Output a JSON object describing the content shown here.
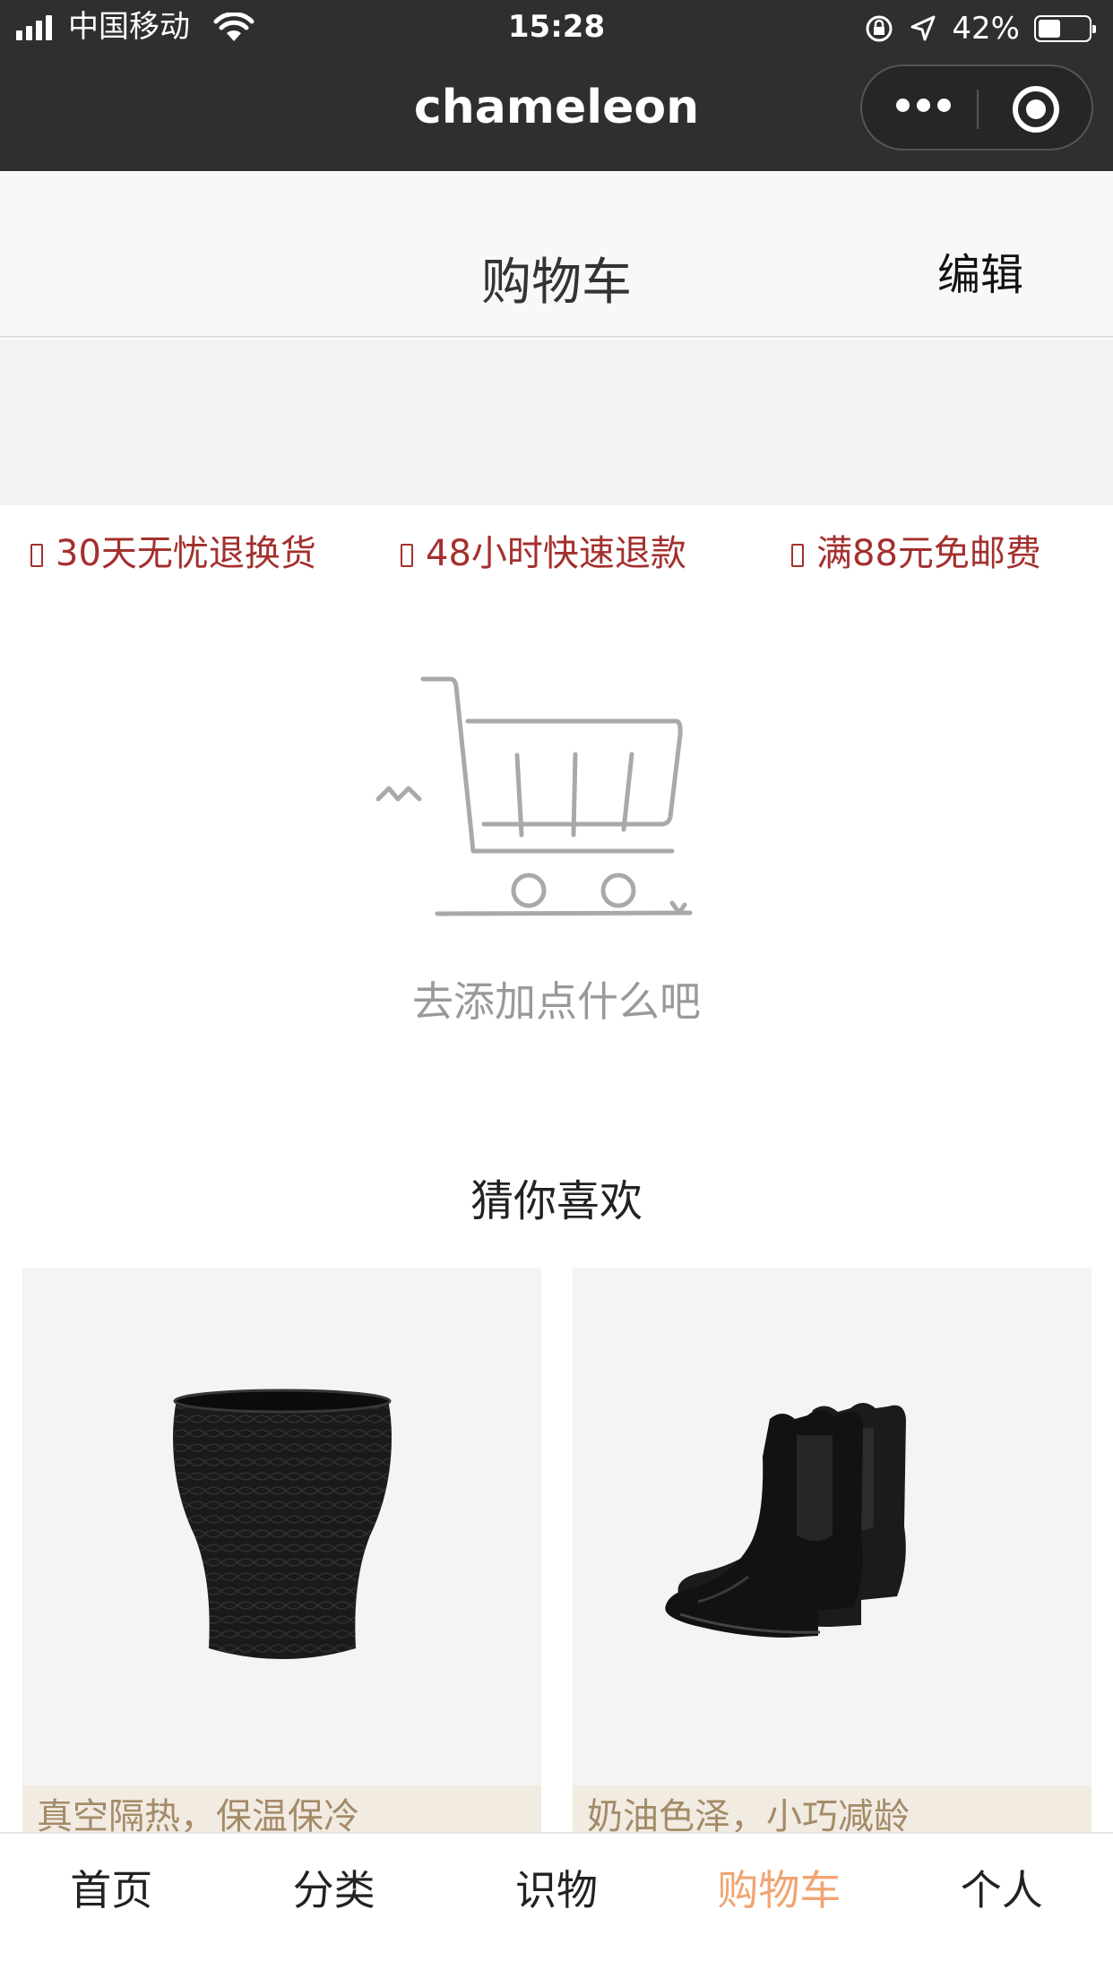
{
  "status_bar": {
    "carrier": "中国移动",
    "time": "15:28",
    "battery": "42%",
    "battery_level": 0.42
  },
  "app": {
    "title": "chameleon"
  },
  "page": {
    "title": "购物车",
    "edit_label": "编辑"
  },
  "guarantees": [
    {
      "label": "30天无忧退换货",
      "icon": "badge-icon"
    },
    {
      "label": "48小时快速退款",
      "icon": "badge-icon"
    },
    {
      "label": "满88元免邮费",
      "icon": "badge-icon"
    }
  ],
  "empty_state": {
    "icon": "shopping-cart-icon",
    "message": "去添加点什么吧"
  },
  "recommendations": {
    "title": "猜你喜欢",
    "items": [
      {
        "description": "真空隔热，保温保冷",
        "image": "black-ceramic-cup"
      },
      {
        "description": "奶油色泽，小巧减龄",
        "image": "black-chelsea-boots"
      }
    ]
  },
  "tabs": [
    {
      "label": "首页",
      "active": false
    },
    {
      "label": "分类",
      "active": false
    },
    {
      "label": "识物",
      "active": false
    },
    {
      "label": "购物车",
      "active": true
    },
    {
      "label": "个人",
      "active": false
    }
  ],
  "colors": {
    "accent": "#f0a572",
    "guarantee_red": "#a3302e",
    "nav_bg": "#2f2f2f"
  }
}
